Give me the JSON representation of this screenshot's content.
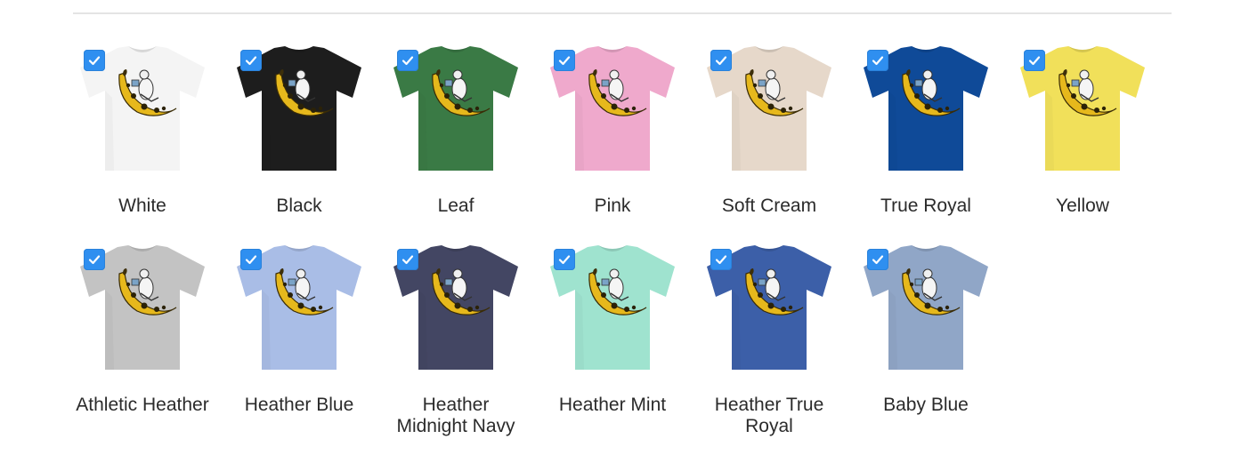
{
  "variants": [
    {
      "label": "White",
      "color": "#f4f4f4",
      "checked": true
    },
    {
      "label": "Black",
      "color": "#1d1d1d",
      "checked": true
    },
    {
      "label": "Leaf",
      "color": "#3a7a45",
      "checked": true
    },
    {
      "label": "Pink",
      "color": "#efa9cc",
      "checked": true
    },
    {
      "label": "Soft Cream",
      "color": "#e6d8ca",
      "checked": true
    },
    {
      "label": "True Royal",
      "color": "#0f4a98",
      "checked": true
    },
    {
      "label": "Yellow",
      "color": "#f1e05a",
      "checked": true
    },
    {
      "label": "Athletic Heather",
      "color": "#c3c3c3",
      "checked": true
    },
    {
      "label": "Heather Blue",
      "color": "#a9bde6",
      "checked": true
    },
    {
      "label": "Heather Midnight Navy",
      "color": "#434663",
      "checked": true
    },
    {
      "label": "Heather Mint",
      "color": "#9fe3cf",
      "checked": true
    },
    {
      "label": "Heather True Royal",
      "color": "#3c5fa8",
      "checked": true
    },
    {
      "label": "Baby Blue",
      "color": "#90a6c7",
      "checked": true
    }
  ],
  "accent_color": "#2f8ff0",
  "design_icon": "banana-graphic-icon",
  "check_icon": "checkmark-icon"
}
